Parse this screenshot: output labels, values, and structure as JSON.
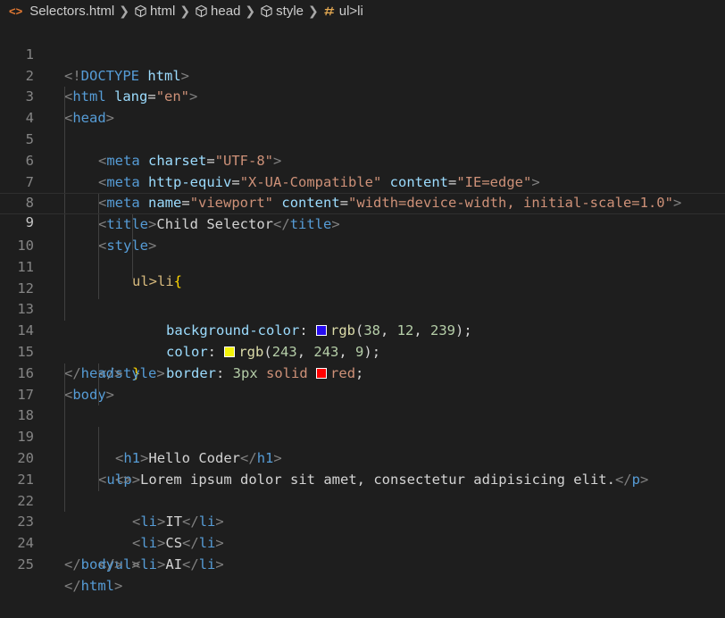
{
  "breadcrumb": {
    "file": "Selectors.html",
    "items": [
      "html",
      "head",
      "style",
      "ul>li"
    ]
  },
  "editor": {
    "active_line": 9,
    "line_numbers": [
      "1",
      "2",
      "3",
      "4",
      "5",
      "6",
      "7",
      "8",
      "9",
      "10",
      "11",
      "12",
      "13",
      "14",
      "15",
      "16",
      "17",
      "18",
      "19",
      "20",
      "21",
      "22",
      "23",
      "24",
      "25"
    ],
    "swatch_colors": {
      "background": "#260cef",
      "color": "#f3f309",
      "border": "#ff0000"
    },
    "text": {
      "doctype_open": "<!",
      "doctype": "DOCTYPE",
      "html_word": "html",
      "lang_attr": "lang",
      "lang_val": "\"en\"",
      "meta": "meta",
      "charset_attr": "charset",
      "charset_val": "\"UTF-8\"",
      "httpequiv_attr": "http-equiv",
      "httpequiv_val": "\"X-UA-Compatible\"",
      "content_attr": "content",
      "ie_val": "\"IE=edge\"",
      "name_attr": "name",
      "viewport_val": "\"viewport\"",
      "viewport_content_val": "\"width=device-width, initial-scale=1.0\"",
      "title_tag": "title",
      "title_text": "Child Selector",
      "style_tag": "style",
      "selector": "ul>li",
      "open_brace": "{",
      "close_brace": "}",
      "bg_prop": "background-color",
      "color_prop": "color",
      "border_prop": "border",
      "rgb_fn": "rgb",
      "bg_r": "38",
      "bg_g": "12",
      "bg_b": "239",
      "c_r": "243",
      "c_g": "243",
      "c_b": "9",
      "border_width": "3px",
      "border_style": "solid",
      "border_color": "red",
      "head_tag": "head",
      "body_tag": "body",
      "h1_tag": "h1",
      "h1_text": "Hello Coder",
      "p_tag": "p",
      "p_text": "Lorem ipsum dolor sit amet, consectetur adipisicing elit.",
      "ul_tag": "ul",
      "li_tag": "li",
      "li1": "IT",
      "li2": "CS",
      "li3": "AI"
    }
  }
}
